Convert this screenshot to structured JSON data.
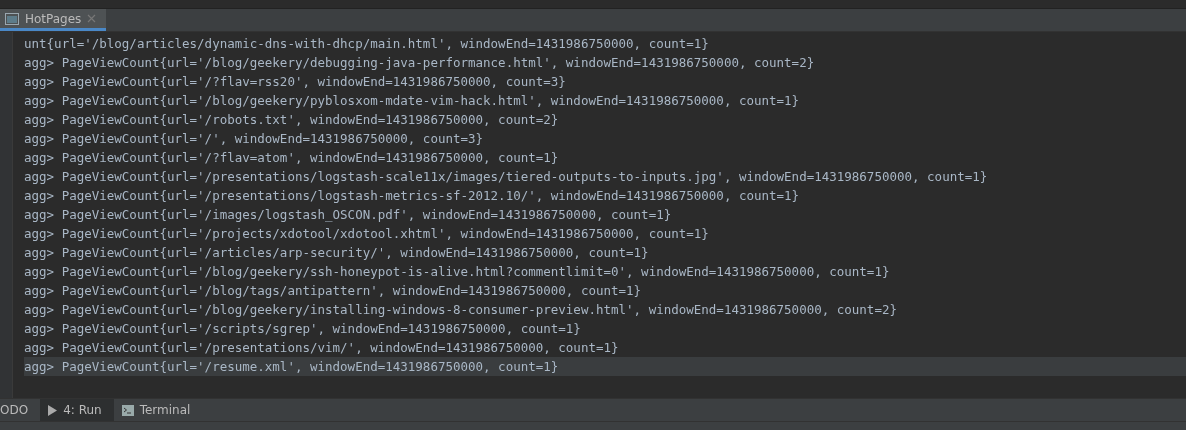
{
  "tab": {
    "title": "HotPages",
    "selected": true
  },
  "console_lines": [
    "unt{url='/blog/articles/dynamic-dns-with-dhcp/main.html', windowEnd=1431986750000, count=1}",
    "agg> PageViewCount{url='/blog/geekery/debugging-java-performance.html', windowEnd=1431986750000, count=2}",
    "agg> PageViewCount{url='/?flav=rss20', windowEnd=1431986750000, count=3}",
    "agg> PageViewCount{url='/blog/geekery/pyblosxom-mdate-vim-hack.html', windowEnd=1431986750000, count=1}",
    "agg> PageViewCount{url='/robots.txt', windowEnd=1431986750000, count=2}",
    "agg> PageViewCount{url='/', windowEnd=1431986750000, count=3}",
    "agg> PageViewCount{url='/?flav=atom', windowEnd=1431986750000, count=1}",
    "agg> PageViewCount{url='/presentations/logstash-scale11x/images/tiered-outputs-to-inputs.jpg', windowEnd=1431986750000, count=1}",
    "agg> PageViewCount{url='/presentations/logstash-metrics-sf-2012.10/', windowEnd=1431986750000, count=1}",
    "agg> PageViewCount{url='/images/logstash_OSCON.pdf', windowEnd=1431986750000, count=1}",
    "agg> PageViewCount{url='/projects/xdotool/xdotool.xhtml', windowEnd=1431986750000, count=1}",
    "agg> PageViewCount{url='/articles/arp-security/', windowEnd=1431986750000, count=1}",
    "agg> PageViewCount{url='/blog/geekery/ssh-honeypot-is-alive.html?commentlimit=0', windowEnd=1431986750000, count=1}",
    "agg> PageViewCount{url='/blog/tags/antipattern', windowEnd=1431986750000, count=1}",
    "agg> PageViewCount{url='/blog/geekery/installing-windows-8-consumer-preview.html', windowEnd=1431986750000, count=2}",
    "agg> PageViewCount{url='/scripts/sgrep', windowEnd=1431986750000, count=1}",
    "agg> PageViewCount{url='/presentations/vim/', windowEnd=1431986750000, count=1}",
    "agg> PageViewCount{url='/resume.xml', windowEnd=1431986750000, count=1}"
  ],
  "tool_tabs": [
    {
      "label": "ODO",
      "kind": "plain",
      "selected": false
    },
    {
      "label": "4: Run",
      "kind": "run",
      "selected": true
    },
    {
      "label": "Terminal",
      "kind": "terminal",
      "selected": false
    }
  ]
}
